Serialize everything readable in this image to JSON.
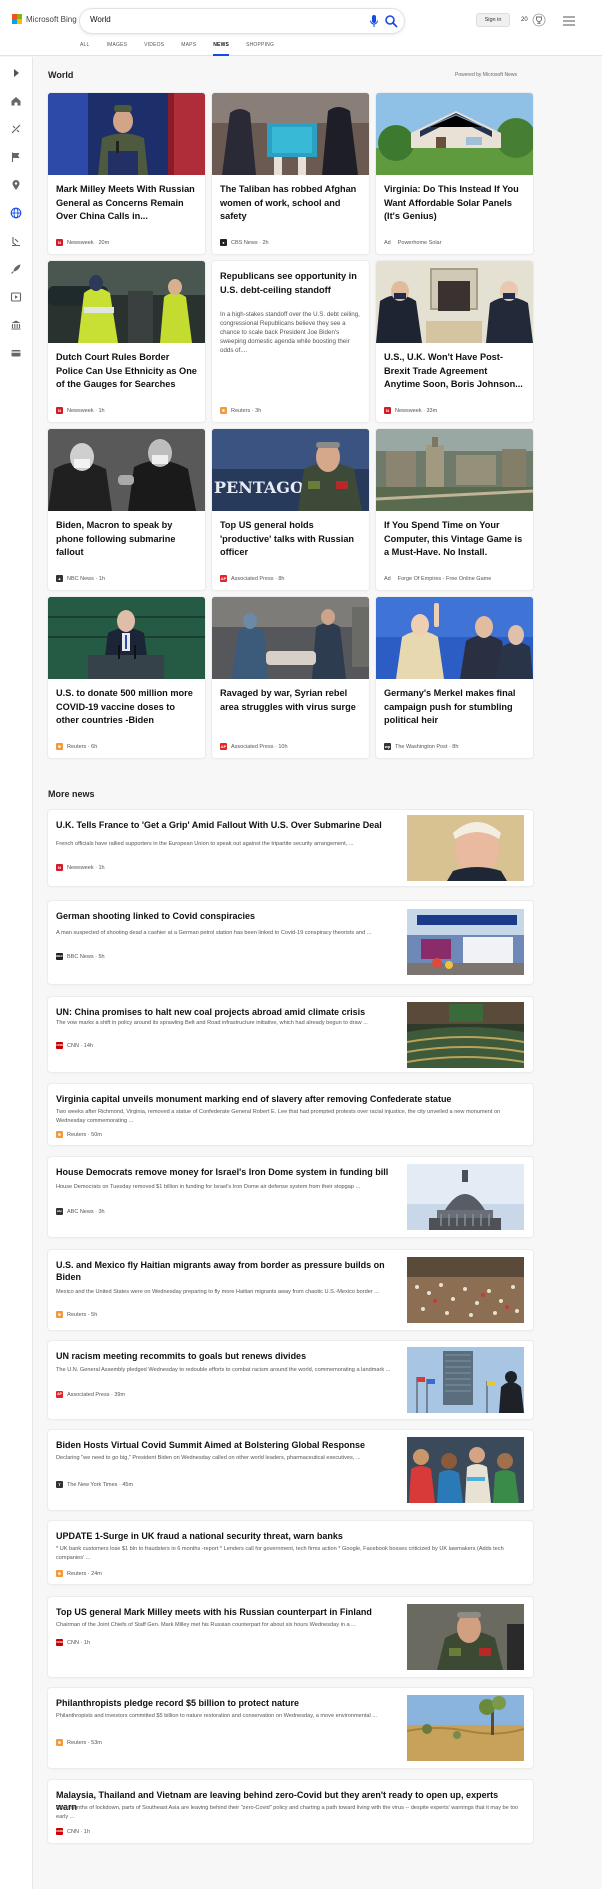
{
  "brand": {
    "logo_text": "Microsoft Bing",
    "colors": {
      "red": "#f25022",
      "green": "#7fba00",
      "blue": "#00a4ef",
      "yellow": "#ffb900",
      "accent": "#174ae4"
    }
  },
  "search": {
    "query": "World"
  },
  "nav": {
    "tabs": [
      {
        "label": "ALL"
      },
      {
        "label": "IMAGES"
      },
      {
        "label": "VIDEOS"
      },
      {
        "label": "MAPS"
      },
      {
        "label": "NEWS",
        "active": true
      },
      {
        "label": "SHOPPING"
      }
    ]
  },
  "header": {
    "signin_label": "Sign in",
    "rewards_count": "20"
  },
  "sidebar": {
    "icons": [
      "expand-icon",
      "home-icon",
      "sports-icon",
      "flag-icon",
      "location-icon",
      "globe-icon",
      "science-icon",
      "rocket-icon",
      "video-icon",
      "bank-icon",
      "wallet-icon"
    ]
  },
  "world": {
    "title": "World",
    "powered_by": "Powered by Microsoft News",
    "cards": [
      {
        "title": "Mark Milley Meets With Russian General as Concerns Remain Over China Calls in...",
        "source": "Newsweek",
        "time": "20m",
        "meta": "Newsweek · 20m",
        "logo": "N",
        "logo_color": "#d21e2b"
      },
      {
        "title": "The Taliban has robbed Afghan women of work, school and safety",
        "source": "CBS News",
        "time": "2h",
        "meta": "CBS News · 2h",
        "logo": "●",
        "logo_color": "#222222"
      },
      {
        "title": "Virginia: Do This Instead If You Want Affordable Solar Panels (It's Genius)",
        "ad_label": "Ad",
        "source": "Powerhome Solar",
        "meta": "Powerhome Solar"
      },
      {
        "title": "Dutch Court Rules Border Police Can Use Ethnicity as One of the Gauges for Searches",
        "source": "Newsweek",
        "time": "1h",
        "meta": "Newsweek · 1h",
        "logo": "N",
        "logo_color": "#d21e2b"
      },
      {
        "title": "Republicans see opportunity in U.S. debt-ceiling standoff",
        "snippet": "In a high-stakes standoff over the U.S. debt ceiling, congressional Republicans believe they see a chance to scale back President Joe Biden's sweeping domestic agenda while boosting their odds of....",
        "source": "Reuters",
        "time": "3h",
        "meta": "Reuters · 3h",
        "logo": "✺",
        "logo_color": "#f59a3c"
      },
      {
        "title": "U.S., U.K. Won't Have Post-Brexit Trade Agreement Anytime Soon, Boris Johnson...",
        "source": "Newsweek",
        "time": "33m",
        "meta": "Newsweek · 33m",
        "logo": "N",
        "logo_color": "#d21e2b"
      },
      {
        "title": "Biden, Macron to speak by phone following submarine fallout",
        "source": "NBC News",
        "time": "1h",
        "meta": "NBC News · 1h",
        "logo": "▲",
        "logo_color": "#333333"
      },
      {
        "title": "Top US general holds 'productive' talks with Russian officer",
        "source": "Associated Press",
        "time": "8h",
        "meta": "Associated Press · 8h",
        "logo": "AP",
        "logo_color": "#e0262a"
      },
      {
        "title": "If You Spend Time on Your Computer, this Vintage Game is a Must-Have. No Install.",
        "ad_label": "Ad",
        "source": "Forge Of Empires - Free Online Game",
        "meta": "Forge Of Empires - Free Online Game"
      },
      {
        "title": "U.S. to donate 500 million more COVID-19 vaccine doses to other countries -Biden",
        "source": "Reuters",
        "time": "6h",
        "meta": "Reuters · 6h",
        "logo": "✺",
        "logo_color": "#f59a3c"
      },
      {
        "title": "Ravaged by war, Syrian rebel area struggles with virus surge",
        "source": "Associated Press",
        "time": "10h",
        "meta": "Associated Press · 10h",
        "logo": "AP",
        "logo_color": "#e0262a"
      },
      {
        "title": "Germany's Merkel makes final campaign push for stumbling political heir",
        "source": "The Washington Post",
        "time": "8h",
        "meta": "The Washington Post · 8h",
        "logo": "wp",
        "logo_color": "#333333"
      }
    ]
  },
  "more_news": {
    "title": "More news",
    "items": [
      {
        "title": "U.K. Tells France to 'Get a Grip' Amid Fallout With U.S. Over Submarine Deal",
        "snippet": "French officials have rallied supporters in the European Union to speak out against the tripartite security arrangement, ...",
        "meta": "Newsweek · 1h",
        "logo": "N",
        "logo_color": "#d21e2b"
      },
      {
        "title": "German shooting linked to Covid conspiracies",
        "snippet": "A man suspected of shooting dead a cashier at a German petrol station has been linked to Covid-19 conspiracy theorists and ...",
        "meta": "BBC News · 5h",
        "logo": "BBC",
        "logo_color": "#222222"
      },
      {
        "title": "UN: China promises to halt new coal projects abroad amid climate crisis",
        "snippet": "The vow marks a shift in policy around its sprawling Belt and Road infrastructure initiative, which had already begun to draw ...",
        "meta": "CNN · 14h",
        "logo": "CNN",
        "logo_color": "#cc0000"
      },
      {
        "title": "Virginia capital unveils monument marking end of slavery after removing Confederate statue",
        "snippet": "Two weeks after Richmond, Virginia, removed a statue of Confederate General Robert E. Lee that had prompted protests over racial injustice, the city unveiled a new monument on Wednesday commemorating ...",
        "meta": "Reuters · 50m",
        "logo": "✺",
        "logo_color": "#f59a3c"
      },
      {
        "title": "House Democrats remove money for Israel's Iron Dome system in funding bill",
        "snippet": "House Democrats on Tuesday removed $1 billion in funding for Israel's Iron Dome air defense system from their stopgap ...",
        "meta": "ABC News · 3h",
        "logo": "abc",
        "logo_color": "#333333"
      },
      {
        "title": "U.S. and Mexico fly Haitian migrants away from border as pressure builds on Biden",
        "snippet": "Mexico and the United States were on Wednesday preparing to fly more Haitian migrants away from chaotic U.S.-Mexico border ...",
        "meta": "Reuters · 5h",
        "logo": "✺",
        "logo_color": "#f59a3c"
      },
      {
        "title": "UN racism meeting recommits to goals but renews divides",
        "snippet": "The U.N. General Assembly pledged Wednesday to redouble efforts to combat racism around the world, commemorating a landmark ...",
        "meta": "Associated Press · 39m",
        "logo": "AP",
        "logo_color": "#e0262a"
      },
      {
        "title": "Biden Hosts Virtual Covid Summit Aimed at Bolstering Global Response",
        "snippet": "Declaring \"we need to go big,\" President Biden on Wednesday called on other world leaders, pharmaceutical executives, ...",
        "meta": "The New York Times · 45m",
        "logo": "T",
        "logo_color": "#333333"
      },
      {
        "title": "UPDATE 1-Surge in UK fraud a national security threat, warn banks",
        "snippet": "* UK bank customers lose $1 bln to fraudsters in 6 months -report * Lenders call for government, tech firms action * Google, Facebook bosses criticized by UK lawmakers (Adds tech companies' ...",
        "meta": "Reuters · 24m",
        "logo": "✺",
        "logo_color": "#f59a3c"
      },
      {
        "title": "Top US general Mark Milley meets with his Russian counterpart in Finland",
        "snippet": "Chairman of the Joint Chiefs of Staff Gen. Mark Milley met his Russian counterpart for about six hours Wednesday in a ...",
        "meta": "CNN · 1h",
        "logo": "CNN",
        "logo_color": "#cc0000"
      },
      {
        "title": "Philanthropists pledge record $5 billion to protect nature",
        "snippet": "Philanthropists and investors committed $5 billion to nature restoration and conservation on Wednesday, a move environmental ...",
        "meta": "Reuters · 53m",
        "logo": "✺",
        "logo_color": "#f59a3c"
      },
      {
        "title": "Malaysia, Thailand and Vietnam are leaving behind zero-Covid but they aren't ready to open up, experts warn",
        "snippet": "After months of lockdown, parts of Southeast Asia are leaving behind their \"zero-Covid\" policy and charting a path toward living with the virus -- despite experts' warnings that it may be too early ...",
        "meta": "CNN · 1h",
        "logo": "CNN",
        "logo_color": "#cc0000"
      }
    ]
  }
}
